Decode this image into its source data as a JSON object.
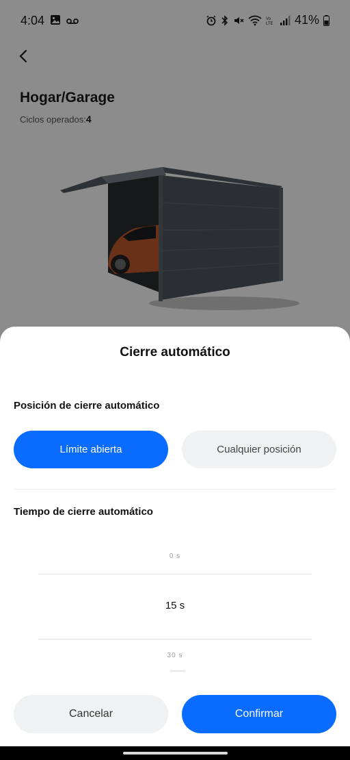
{
  "status_bar": {
    "time": "4:04",
    "battery": "41%",
    "left_icons": [
      "gallery-icon",
      "voicemail-icon"
    ],
    "right_icons": [
      "alarm-icon",
      "bluetooth-icon",
      "mute-icon",
      "wifi-icon",
      "volte-icon",
      "signal-icon",
      "battery-icon"
    ]
  },
  "header": {
    "back_icon": "chevron-left-icon",
    "title": "Hogar/Garage",
    "cycles_label": "Ciclos operados:",
    "cycles_value": "4"
  },
  "sheet": {
    "title": "Cierre automático",
    "position_section": {
      "label": "Posición de cierre automático",
      "options": [
        "Límite abierta",
        "Cualquier posición"
      ],
      "selected": "Límite abierta"
    },
    "time_section": {
      "label": "Tiempo de cierre automático",
      "picker_items": [
        "0 s",
        "15 s",
        "30 s"
      ],
      "selected": "15 s"
    },
    "cancel_label": "Cancelar",
    "confirm_label": "Confirmar"
  },
  "colors": {
    "accent": "#0a6cff",
    "inactive_button": "#f0f1f3"
  }
}
